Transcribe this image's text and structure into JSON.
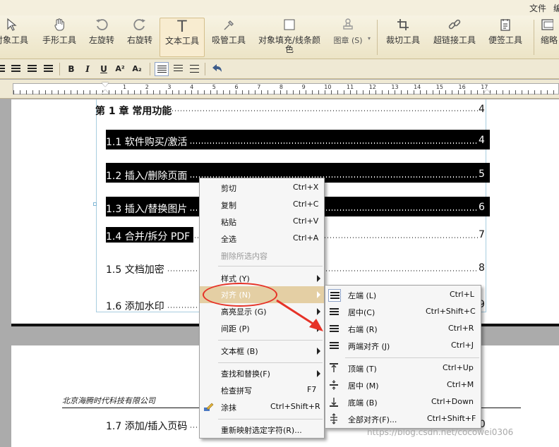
{
  "menubar": {
    "items": [
      "文件",
      "编"
    ]
  },
  "ribbon": {
    "buttons": [
      {
        "label": "对象工具",
        "icon": "cursor-icon"
      },
      {
        "label": "手形工具",
        "icon": "hand-icon"
      },
      {
        "label": "左旋转",
        "icon": "rotate-left-icon"
      },
      {
        "label": "右旋转",
        "icon": "rotate-right-icon"
      },
      {
        "label": "文本工具",
        "icon": "text-tool-icon"
      },
      {
        "label": "吸管工具",
        "icon": "eyedropper-icon"
      },
      {
        "label": "对象填充/线条颜色",
        "icon": "fill-color-icon"
      },
      {
        "label": "图章 (S)",
        "icon": "stamp-icon"
      },
      {
        "label": "裁切工具",
        "icon": "crop-icon"
      },
      {
        "label": "超链接工具",
        "icon": "link-icon"
      },
      {
        "label": "便签工具",
        "icon": "note-icon"
      },
      {
        "label": "缩略",
        "icon": "thumbnail-icon"
      }
    ]
  },
  "format_bar": {
    "bold": "B",
    "italic": "I",
    "underline": "U",
    "superscript": "A²",
    "subscript": "A₂"
  },
  "ruler": {
    "numbers": [
      "1",
      "2",
      "3",
      "4",
      "5",
      "6",
      "7",
      "8",
      "9",
      "10",
      "11",
      "12",
      "13",
      "14",
      "15",
      "16",
      "17"
    ]
  },
  "document": {
    "chapter": {
      "title": "第 1 章  常用功能",
      "page": "4"
    },
    "entries": [
      {
        "title": "1.1 软件购买/激活",
        "page": "4"
      },
      {
        "title": "1.2 插入/删除页面",
        "page": "5"
      },
      {
        "title": "1.3 插入/替换图片",
        "page": "6"
      },
      {
        "title": "1.4 合并/拆分 PDF",
        "page": "7"
      },
      {
        "title": "1.5 文档加密",
        "page": "8"
      },
      {
        "title": "1.6 添加水印",
        "page": "9"
      }
    ],
    "page2_header": "北京海腾时代科技有限公司",
    "page2_entry": {
      "title": "1.7 添加/插入页码",
      "page": "10"
    }
  },
  "context_menu": {
    "items": [
      {
        "label": "剪切",
        "shortcut": "Ctrl+X"
      },
      {
        "label": "复制",
        "shortcut": "Ctrl+C"
      },
      {
        "label": "粘贴",
        "shortcut": "Ctrl+V"
      },
      {
        "label": "全选",
        "shortcut": "Ctrl+A"
      },
      {
        "label": "删除所选内容",
        "shortcut": ""
      },
      {
        "label": "样式 (Y)",
        "shortcut": ""
      },
      {
        "label": "对齐 (N)",
        "shortcut": ""
      },
      {
        "label": "高亮显示 (G)",
        "shortcut": ""
      },
      {
        "label": "间距 (P)",
        "shortcut": ""
      },
      {
        "label": "文本框 (B)",
        "shortcut": ""
      },
      {
        "label": "查找和替换(F)",
        "shortcut": ""
      },
      {
        "label": "检查拼写",
        "shortcut": "F7"
      },
      {
        "label": "涂抹",
        "shortcut": "Ctrl+Shift+R"
      },
      {
        "label": "重新映射选定字符(R)...",
        "shortcut": ""
      }
    ]
  },
  "align_submenu": {
    "items": [
      {
        "label": "左端 (L)",
        "shortcut": "Ctrl+L"
      },
      {
        "label": "居中(C)",
        "shortcut": "Ctrl+Shift+C"
      },
      {
        "label": "右端 (R)",
        "shortcut": "Ctrl+R"
      },
      {
        "label": "两端对齐 (J)",
        "shortcut": "Ctrl+J"
      },
      {
        "label": "顶端 (T)",
        "shortcut": "Ctrl+Up"
      },
      {
        "label": "居中 (M)",
        "shortcut": "Ctrl+M"
      },
      {
        "label": "底端 (B)",
        "shortcut": "Ctrl+Down"
      },
      {
        "label": "全部对齐(F)...",
        "shortcut": "Ctrl+Shift+F"
      }
    ]
  },
  "watermark": "https://blog.csdn.net/cocowei0306",
  "colors": {
    "annotation": "#e63227",
    "highlight": "#e4cfa4",
    "selection": "#000000"
  }
}
